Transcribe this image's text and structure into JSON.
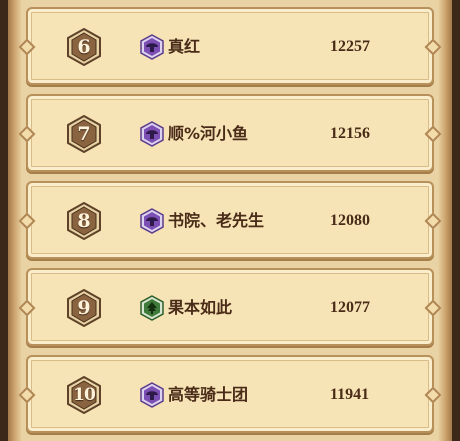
{
  "leaderboard": {
    "rows": [
      {
        "rank": "6",
        "name": "真红",
        "score": "12257",
        "badge_icon": "purple-mushroom-badge-icon",
        "badge_color": "#7b4fb3"
      },
      {
        "rank": "7",
        "name": "顺%河小鱼",
        "score": "12156",
        "badge_icon": "purple-mushroom-badge-icon",
        "badge_color": "#7b4fb3"
      },
      {
        "rank": "8",
        "name": "书院、老先生",
        "score": "12080",
        "badge_icon": "purple-mushroom-badge-icon",
        "badge_color": "#7b4fb3"
      },
      {
        "rank": "9",
        "name": "果本如此",
        "score": "12077",
        "badge_icon": "green-tree-badge-icon",
        "badge_color": "#3f7a3a"
      },
      {
        "rank": "10",
        "name": "高等骑士团",
        "score": "11941",
        "badge_icon": "purple-mushroom-badge-icon",
        "badge_color": "#7b4fb3"
      }
    ]
  },
  "colors": {
    "panel": "#f6e4b6",
    "text": "#4a2b18",
    "hexagon": "#8a6440"
  }
}
